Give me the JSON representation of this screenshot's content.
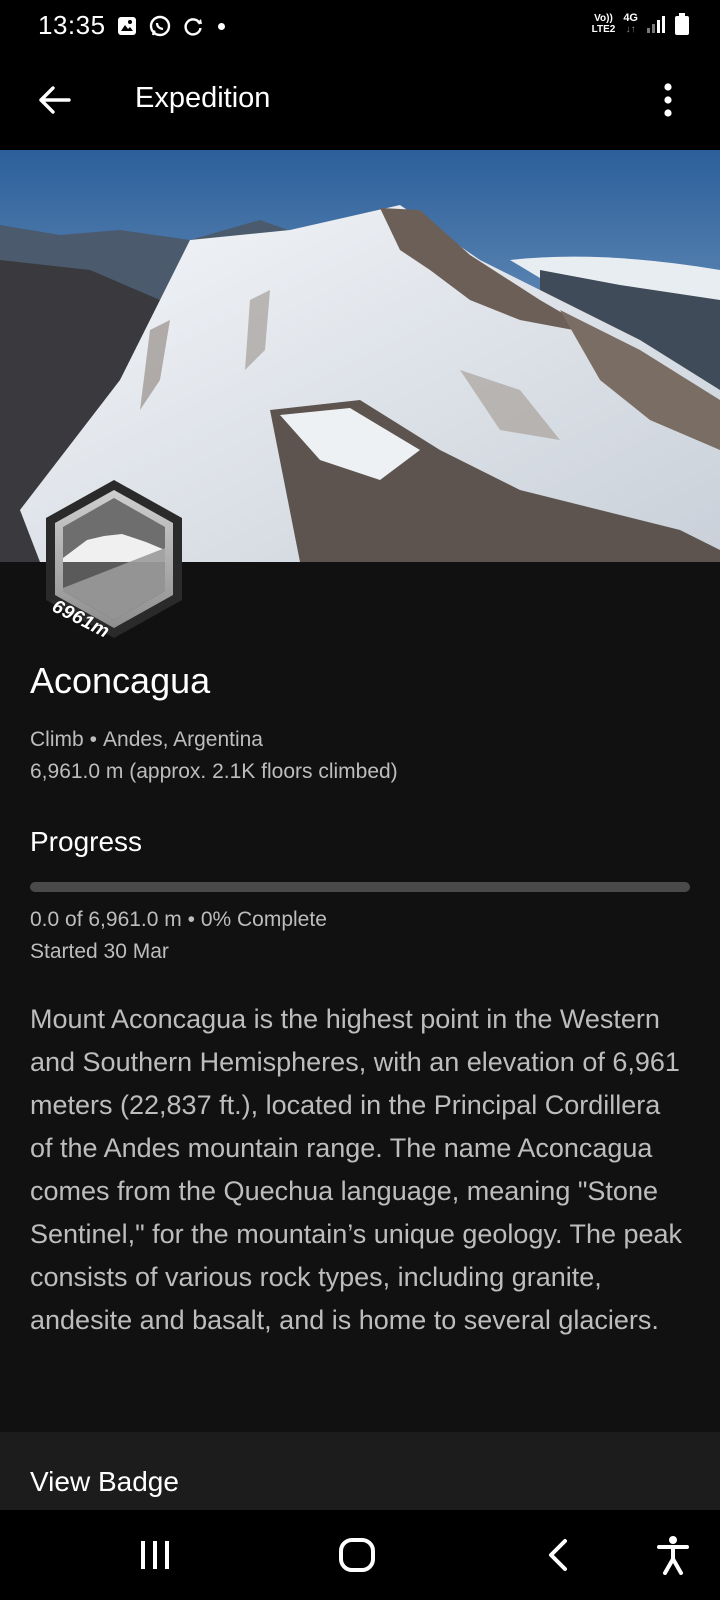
{
  "status_bar": {
    "time": "13:35",
    "volte_line1": "Vo))",
    "volte_line2": "LTE2",
    "network": "4G"
  },
  "app_bar": {
    "title": "Expedition"
  },
  "badge": {
    "label": "6961m"
  },
  "expedition": {
    "name": "Aconcagua",
    "type": "Climb",
    "location": "Andes, Argentina",
    "elevation_text": "6,961.0 m (approx. 2.1K floors climbed)"
  },
  "progress": {
    "heading": "Progress",
    "summary": "0.0 of 6,961.0 m",
    "percent_text": "0% Complete",
    "fraction": 0,
    "started": "Started 30 Mar"
  },
  "description": "Mount Aconcagua is the highest point in the Western and Southern Hemispheres, with an elevation of 6,961 meters (22,837 ft.), located in the Principal Cordillera of the Andes mountain range. The name Aconcagua comes from the Quechua language, meaning \"Stone Sentinel,\" for the mountain’s unique geology. The peak consists of various rock types, including granite, andesite and basalt, and is home to several glaciers.",
  "actions": {
    "view_badge": "View Badge"
  },
  "colors": {
    "background": "#111111",
    "bar": "#000000",
    "secondary_text": "#bdbdbd",
    "progress_track": "#4a4a4a"
  }
}
